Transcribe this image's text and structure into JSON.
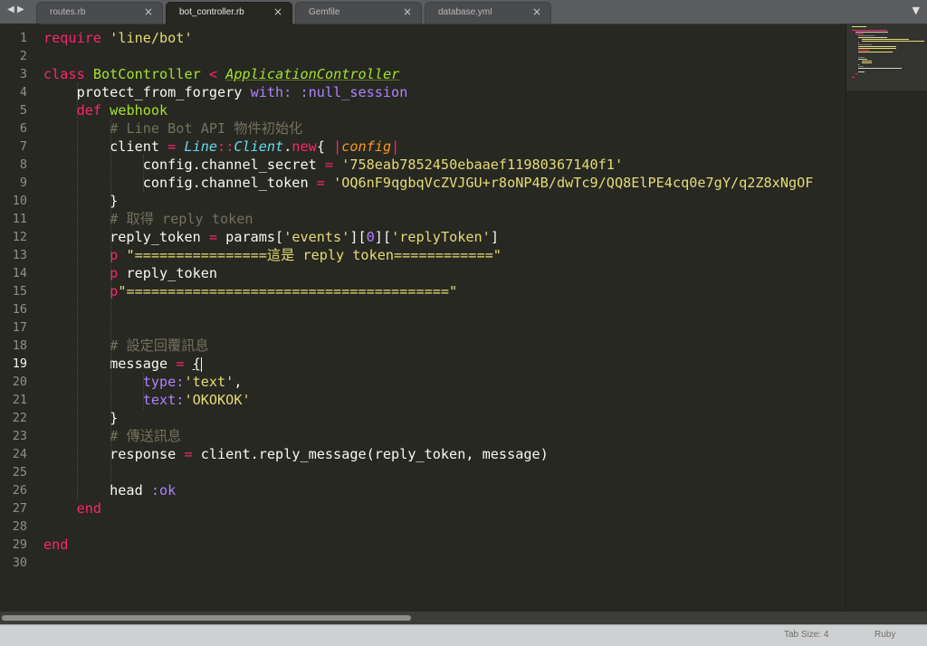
{
  "window": {
    "tabs": [
      {
        "label": "routes.rb",
        "active": false
      },
      {
        "label": "bot_controller.rb",
        "active": true
      },
      {
        "label": "Gemfile",
        "active": false
      },
      {
        "label": "database.yml",
        "active": false
      }
    ],
    "nav_icon": "left-right-arrows",
    "close_icon": "×",
    "dropdown_icon": "▼"
  },
  "editor": {
    "current_line": 19,
    "theme_colors": {
      "background": "#272822",
      "keyword": "#f92672",
      "class": "#a6e22e",
      "string": "#e6db74",
      "constant": "#ae81ff",
      "comment": "#75715e",
      "support": "#66d9ef",
      "parameter": "#fd971f"
    },
    "lines": [
      "require 'line/bot'",
      "",
      "class BotController < ApplicationController",
      "    protect_from_forgery with: :null_session",
      "    def webhook",
      "        # Line Bot API 物件初始化",
      "        client = Line::Client.new{ |config|",
      "            config.channel_secret = '758eab7852450ebaaef11980367140f1'",
      "            config.channel_token = 'OQ6nF9qgbqVcZVJGU+r8oNP4B/dwTc9/QQ8ElPE4cq0e7gY/q2Z8xNgOF",
      "        }",
      "        # 取得 reply token",
      "        reply_token = params['events'][0]['replyToken']",
      "        p \"================這是 reply token============\"",
      "        p reply_token",
      "        p\"=======================================\"",
      "",
      "",
      "        # 設定回覆訊息",
      "        message = {",
      "            type:'text',",
      "            text:'OKOKOK'",
      "        }",
      "        # 傳送訊息",
      "        response = client.reply_message(reply_token, message)",
      "",
      "        head :ok",
      "    end",
      "",
      "end",
      ""
    ]
  },
  "status": {
    "tab_size": "Tab Size: 4",
    "syntax": "Ruby"
  }
}
